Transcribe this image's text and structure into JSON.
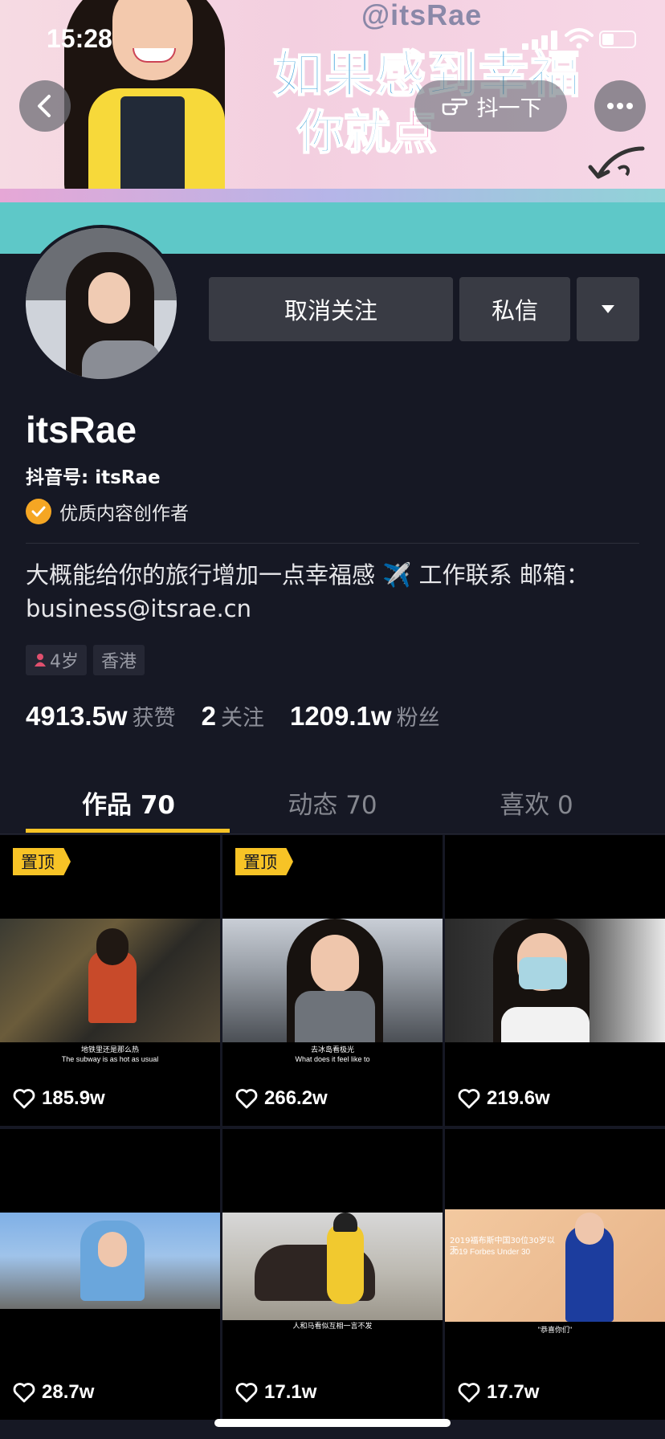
{
  "status_bar": {
    "time": "15:28"
  },
  "banner": {
    "handle": "@itsRae",
    "slogan_line1": "如果感到幸福",
    "slogan_line2_a": "你就",
    "slogan_line2_b": "点",
    "shake_label": "抖一下"
  },
  "actions": {
    "unfollow": "取消关注",
    "message": "私信"
  },
  "profile": {
    "name": "itsRae",
    "douyin_id": "抖音号: itsRae",
    "creator_label": "优质内容创作者",
    "bio": "大概能给你的旅行增加一点幸福感 ✈️ 工作联系 邮箱：business@itsrae.cn",
    "tags": {
      "age": "4岁",
      "location": "香港"
    }
  },
  "stats": {
    "likes_num": "4913.5w",
    "likes_label": "获赞",
    "following_num": "2",
    "following_label": "关注",
    "fans_num": "1209.1w",
    "fans_label": "粉丝"
  },
  "tabs": [
    {
      "label": "作品 70",
      "active": true
    },
    {
      "label": "动态 70",
      "active": false
    },
    {
      "label": "喜欢 0",
      "active": false
    }
  ],
  "pin_label": "置顶",
  "videos": [
    {
      "likes": "185.9w",
      "pinned": true,
      "caption_cn": "地铁里还是那么热",
      "caption_en": "The subway is as hot as usual"
    },
    {
      "likes": "266.2w",
      "pinned": true,
      "caption_cn": "去冰岛看极光",
      "caption_en": "What does it feel like to"
    },
    {
      "likes": "219.6w",
      "pinned": false,
      "caption_cn": "",
      "caption_en": ""
    },
    {
      "likes": "28.7w",
      "pinned": false,
      "caption_cn": "",
      "caption_en": ""
    },
    {
      "likes": "17.1w",
      "pinned": false,
      "caption_cn": "人和马看似互相一言不发",
      "caption_en": ""
    },
    {
      "likes": "17.7w",
      "pinned": false,
      "caption_cn": "\"恭喜你们\"",
      "caption_en": "",
      "overlay_1": "2019福布斯中国30位30岁以下",
      "overlay_2": "2019 Forbes Under 30"
    }
  ],
  "colors": {
    "background": "#161824",
    "accent": "#f7c326",
    "button": "#393b44",
    "banner_teal": "#5ec8c8"
  }
}
